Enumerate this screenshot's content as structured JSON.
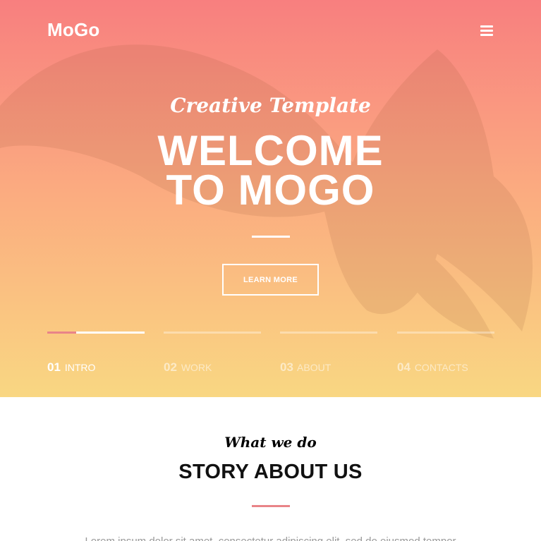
{
  "header": {
    "brand": "MoGo",
    "menu_icon": "hamburger-menu-icon"
  },
  "hero": {
    "subtitle": "Creative Template",
    "title_line1": "WELCOME",
    "title_line2": "TO MOGO",
    "button_label": "LEARN MORE",
    "slides": [
      {
        "number": "01",
        "label": "INTRO",
        "active": true,
        "progress": 0.3
      },
      {
        "number": "02",
        "label": "WORK",
        "active": false,
        "progress": 0
      },
      {
        "number": "03",
        "label": "ABOUT",
        "active": false,
        "progress": 0
      },
      {
        "number": "04",
        "label": "CONTACTS",
        "active": false,
        "progress": 0
      }
    ]
  },
  "about": {
    "kicker": "What we do",
    "title": "STORY ABOUT US",
    "text": "Lorem ipsum dolor sit amet, consectetur adipiscing elit, sed do eiusmod tempor"
  },
  "colors": {
    "gradient_top": "#f87f7f",
    "gradient_mid": "#fbab80",
    "gradient_bottom": "#f9d782",
    "accent": "#e98488"
  }
}
